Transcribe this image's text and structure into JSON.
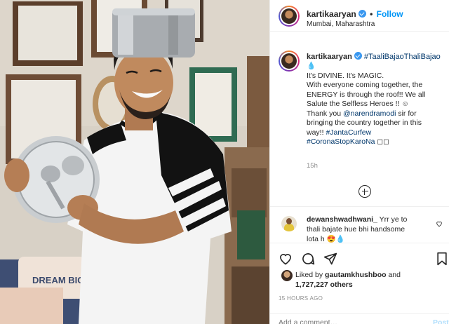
{
  "photo": {
    "alt": "Man wearing a steel pot on his head holding a plate and spoon",
    "sign_text": "DREAM BIG"
  },
  "header": {
    "username": "kartikaaryan",
    "separator": "•",
    "follow_label": "Follow",
    "location": "Mumbai, Maharashtra"
  },
  "caption": {
    "username": "kartikaaryan",
    "hashtag": "#TaaliBajaoThaliBajao",
    "emoji_line": "💧",
    "line1": "It's DIVINE. It's MAGIC.",
    "line2": "With everyone coming together, the",
    "line3": "ENERGY is through the roof!! We all",
    "line4": "Salute the Selfless Heroes !! ☺",
    "line5_prefix": "Thank you ",
    "mention": "@narendramodi",
    "line5_suffix": " sir for",
    "line6": "bringing the country together in this",
    "line7_prefix": "way!! ",
    "tag_curfew": "#JantaCurfew",
    "tag_corona": "#CoronaStopKaroNa",
    "tag_corona_suffix": " ◻◻",
    "time_ago": "15h"
  },
  "comment": {
    "username": "dewanshwadhwani_",
    "text_part1": " Yrr ye to",
    "text_part2": "thali bajate hue bhi handsome",
    "text_part3": "lota h 😍💧"
  },
  "actions": {
    "liked_by_prefix": "Liked by ",
    "liked_by_user": "gautamkhushboo",
    "liked_by_and": " and",
    "likes_count": "1,727,227 others",
    "post_time": "15 HOURS AGO",
    "add_comment_placeholder": "Add a comment…",
    "post_label": "Post"
  },
  "colors": {
    "link_blue": "#0095f6",
    "hashtag_dark_blue": "#00376b",
    "muted_gray": "#8e8e8e"
  },
  "icons": [
    "heart-icon",
    "comment-icon",
    "share-icon",
    "bookmark-icon",
    "add-circle-icon",
    "verified-badge-icon"
  ]
}
